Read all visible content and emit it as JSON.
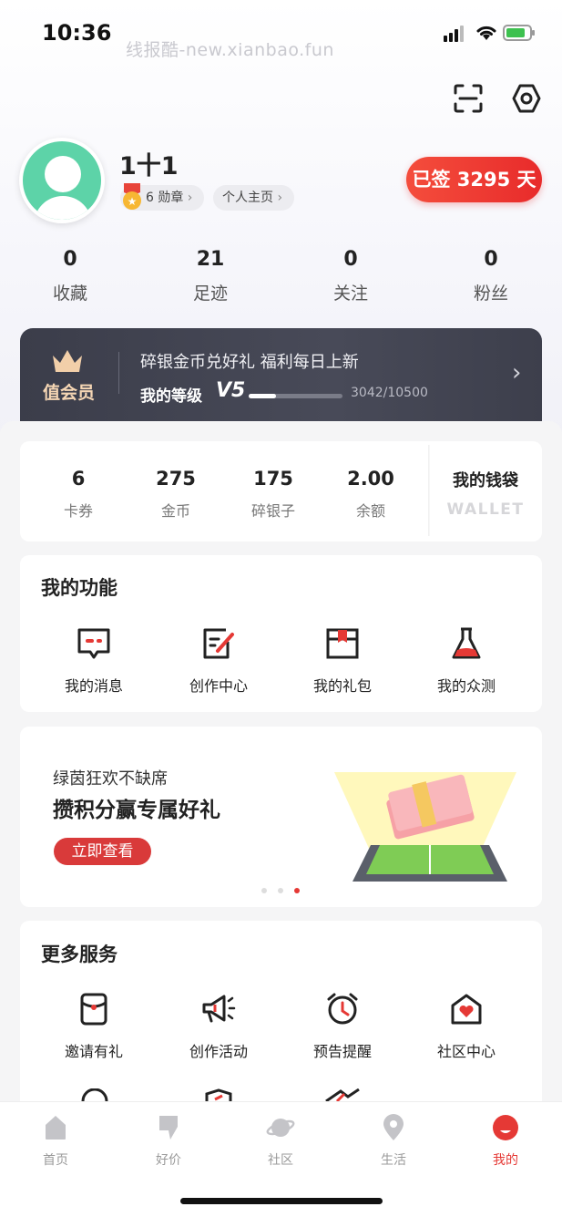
{
  "status_bar": {
    "time": "10:36",
    "watermark": "线报酷-new.xianbao.fun"
  },
  "profile": {
    "username": "1十1",
    "medal_label": "6 勋章",
    "homepage_label": "个人主页",
    "signin_label": "已签 3295 天"
  },
  "stats": [
    {
      "value": "0",
      "label": "收藏"
    },
    {
      "value": "21",
      "label": "足迹"
    },
    {
      "value": "0",
      "label": "关注"
    },
    {
      "value": "0",
      "label": "粉丝"
    }
  ],
  "vip": {
    "label": "值会员",
    "promo": "碎银金币兑好礼 福利每日上新",
    "level_prefix": "我的等级",
    "level": "V5",
    "progress_text": "3042/10500",
    "progress_fraction": 0.29
  },
  "wallet": {
    "items": [
      {
        "value": "6",
        "label": "卡券"
      },
      {
        "value": "275",
        "label": "金币"
      },
      {
        "value": "175",
        "label": "碎银子"
      },
      {
        "value": "2.00",
        "label": "余额"
      }
    ],
    "title": "我的钱袋",
    "subtitle": "WALLET"
  },
  "functions": {
    "title": "我的功能",
    "items": [
      {
        "label": "我的消息",
        "icon": "message-icon"
      },
      {
        "label": "创作中心",
        "icon": "edit-icon"
      },
      {
        "label": "我的礼包",
        "icon": "gift-icon"
      },
      {
        "label": "我的众测",
        "icon": "flask-icon"
      }
    ]
  },
  "banner": {
    "subtitle": "绿茵狂欢不缺席",
    "title": "攒积分赢专属好礼",
    "button": "立即查看",
    "dots": 3,
    "active_dot": 3
  },
  "services": {
    "title": "更多服务",
    "items": [
      {
        "label": "邀请有礼",
        "icon": "invite-icon"
      },
      {
        "label": "创作活动",
        "icon": "megaphone-icon"
      },
      {
        "label": "预告提醒",
        "icon": "alarm-icon"
      },
      {
        "label": "社区中心",
        "icon": "community-house-icon"
      }
    ]
  },
  "tabbar": {
    "items": [
      {
        "label": "首页",
        "icon": "home-icon"
      },
      {
        "label": "好价",
        "icon": "deal-icon"
      },
      {
        "label": "社区",
        "icon": "planet-icon"
      },
      {
        "label": "生活",
        "icon": "location-icon"
      },
      {
        "label": "我的",
        "icon": "profile-icon"
      }
    ],
    "active": "我的"
  },
  "colors": {
    "accent": "#e53935",
    "vip_bg": "#43454f",
    "avatar": "#5dd3a8",
    "vip_gold": "#f5d6b4"
  }
}
